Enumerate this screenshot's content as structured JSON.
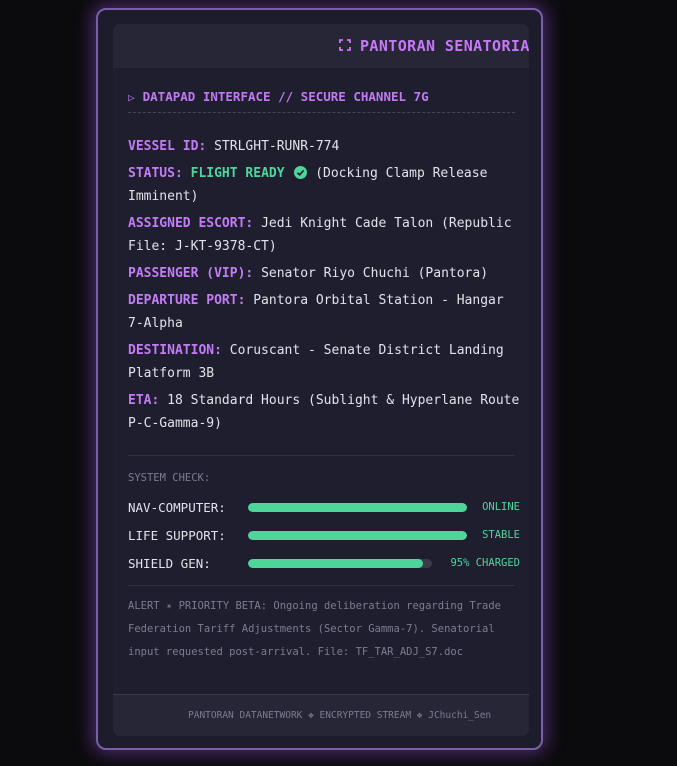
{
  "header": {
    "title": "PANTORAN SENATORIAL",
    "icon": "scan-frame-icon"
  },
  "panel": {
    "subtitle_icon": "play-icon",
    "subtitle_glyph": "▷",
    "subtitle": "DATAPAD INTERFACE // SECURE CHANNEL 7G",
    "fields": {
      "vessel_label": "VESSEL ID:",
      "vessel_value": "STRLGHT-RUNR-774",
      "status_label": "STATUS:",
      "status_value": "FLIGHT READY",
      "status_note": "(Docking Clamp Release Imminent)",
      "escort_label": "ASSIGNED ESCORT:",
      "escort_value": "Jedi Knight Cade Talon (Republic File: J-KT-9378-CT)",
      "passenger_label": "PASSENGER (VIP):",
      "passenger_value": "Senator Riyo Chuchi (Pantora)",
      "departure_label": "DEPARTURE PORT:",
      "departure_value": "Pantora Orbital Station - Hangar 7-Alpha",
      "destination_label": "DESTINATION:",
      "destination_value": "Coruscant - Senate District Landing Platform 3B",
      "eta_label": "ETA:",
      "eta_value": "18 Standard Hours (Sublight & Hyperlane Route P-C-Gamma-9)"
    },
    "system_check": {
      "title": "SYSTEM CHECK:",
      "items": [
        {
          "label": "NAV-COMPUTER:",
          "level": 1.0,
          "status": "ONLINE"
        },
        {
          "label": "LIFE SUPPORT:",
          "level": 1.0,
          "status": "STABLE"
        },
        {
          "label": "SHIELD GEN:",
          "level": 0.95,
          "status": "95% CHARGED"
        }
      ]
    },
    "alert": "ALERT ✴ PRIORITY BETA: Ongoing deliberation regarding Trade Federation Tariff Adjustments (Sector Gamma-7). Senatorial input requested post-arrival. File: TF_TAR_ADJ_S7.doc"
  },
  "footer": {
    "text": "PANTORAN DATANETWORK ❖ ENCRYPTED STREAM ❖ JChuchi_Sen"
  },
  "colors": {
    "accent": "#c47cf5",
    "ok": "#4ed69a",
    "muted": "#7c7c90",
    "glow": "#7a5fa6"
  }
}
